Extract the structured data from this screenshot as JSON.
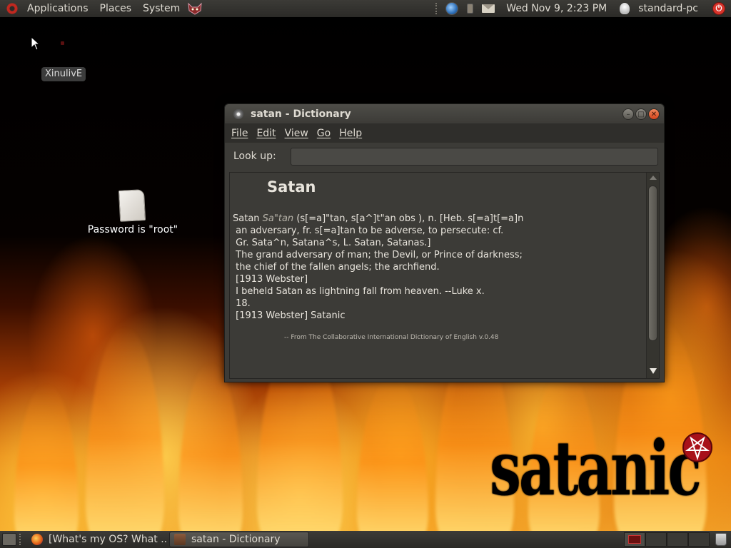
{
  "top_panel": {
    "menus": [
      "Applications",
      "Places",
      "System"
    ],
    "clock": "Wed Nov  9,  2:23 PM",
    "username": "standard-pc"
  },
  "desktop": {
    "icons": [
      {
        "label": "XinulivE"
      },
      {
        "label": "Password is \"root\""
      }
    ],
    "logo_text": "satanic"
  },
  "window": {
    "title": "satan - Dictionary",
    "menus": [
      "File",
      "Edit",
      "View",
      "Go",
      "Help"
    ],
    "lookup_label": "Look up:",
    "lookup_value": "",
    "headword": "Satan",
    "entry": {
      "word": "Satan",
      "pronunciation": "Sa\"tan",
      "etym_line1_rest": " (s[=a]\"tan, s[a^]t\"an obs ), n. [Heb. s[=a]t[=a]n",
      "lines": [
        " an adversary, fr. s[=a]tan to be adverse, to persecute: cf.",
        " Gr. Sata^n, Satana^s, L. Satan, Satanas.]",
        " The grand adversary of man; the Devil, or Prince of darkness;",
        " the chief of the fallen angels; the archfiend.",
        " [1913 Webster]",
        "",
        " I beheld Satan as lightning fall from heaven. --Luke x.",
        " 18.",
        " [1913 Webster] Satanic"
      ],
      "source": "-- From The Collaborative International Dictionary of English v.0.48"
    }
  },
  "taskbar": {
    "tasks": [
      {
        "label": "[What's my OS? What ...",
        "active": false
      },
      {
        "label": "satan - Dictionary",
        "active": true
      }
    ]
  }
}
